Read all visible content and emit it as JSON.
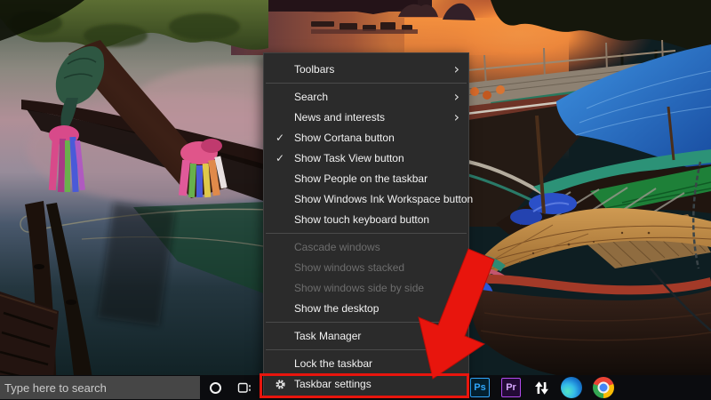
{
  "context_menu": {
    "items": [
      {
        "label": "Toolbars",
        "type": "submenu"
      },
      {
        "type": "separator"
      },
      {
        "label": "Search",
        "type": "submenu"
      },
      {
        "label": "News and interests",
        "type": "submenu"
      },
      {
        "label": "Show Cortana button",
        "checked": true
      },
      {
        "label": "Show Task View button",
        "checked": true
      },
      {
        "label": "Show People on the taskbar",
        "checked": false
      },
      {
        "label": "Show Windows Ink Workspace button",
        "checked": false
      },
      {
        "label": "Show touch keyboard button",
        "checked": false
      },
      {
        "type": "separator"
      },
      {
        "label": "Cascade windows",
        "disabled": true
      },
      {
        "label": "Show windows stacked",
        "disabled": true
      },
      {
        "label": "Show windows side by side",
        "disabled": true
      },
      {
        "label": "Show the desktop"
      },
      {
        "type": "separator"
      },
      {
        "label": "Task Manager"
      },
      {
        "type": "separator"
      },
      {
        "label": "Lock the taskbar"
      },
      {
        "label": "Taskbar settings",
        "icon": "gear-icon",
        "highlighted": true
      }
    ]
  },
  "taskbar": {
    "search_placeholder": "Type here to search",
    "buttons": [
      {
        "name": "cortana-button"
      },
      {
        "name": "task-view-button"
      }
    ],
    "pinned_apps": [
      {
        "name": "photoshop",
        "label": "Ps",
        "accent": "#31a8ff"
      },
      {
        "name": "premiere-pro",
        "label": "Pr",
        "accent": "#b14aed"
      },
      {
        "name": "transfer-arrows-app"
      },
      {
        "name": "microsoft-edge"
      },
      {
        "name": "google-chrome"
      }
    ]
  },
  "annotations": {
    "highlight_color": "#e8150d",
    "highlighted_item": "Taskbar settings"
  }
}
